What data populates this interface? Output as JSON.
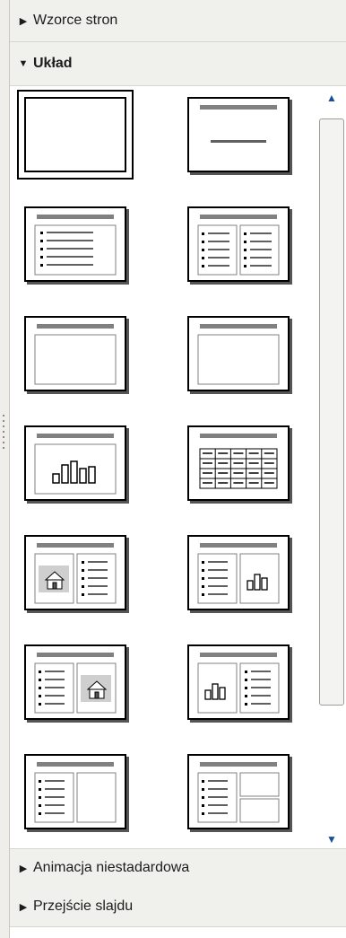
{
  "sections": {
    "wzorce": {
      "label": "Wzorce stron",
      "arrow": "▶"
    },
    "uklad": {
      "label": "Układ",
      "arrow": "▼"
    },
    "animacja": {
      "label": "Animacja niestadardowa",
      "arrow": "▶"
    },
    "przejscie": {
      "label": "Przejście slajdu",
      "arrow": "▶"
    }
  },
  "scrollbar": {
    "up": "▲",
    "down": "▼"
  },
  "layouts": [
    {
      "name": "blank",
      "selected": true
    },
    {
      "name": "title-only-centered"
    },
    {
      "name": "title-bullets"
    },
    {
      "name": "title-two-column-bullets"
    },
    {
      "name": "title-content"
    },
    {
      "name": "title-content-box"
    },
    {
      "name": "title-chart"
    },
    {
      "name": "title-table"
    },
    {
      "name": "title-image-bullets"
    },
    {
      "name": "title-bullets-chart"
    },
    {
      "name": "title-bullets-image"
    },
    {
      "name": "title-chart-bullets"
    },
    {
      "name": "title-bullets-content"
    },
    {
      "name": "title-bullets-two-boxes"
    }
  ]
}
